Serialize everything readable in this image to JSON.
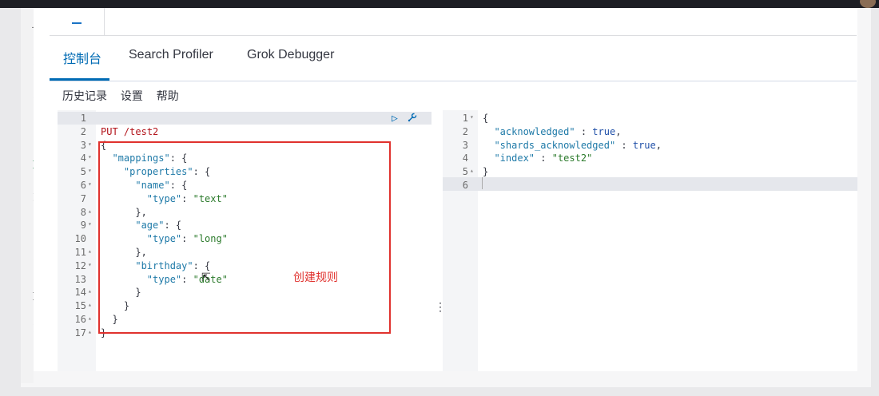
{
  "tabs": [
    {
      "label": "控制台",
      "active": true
    },
    {
      "label": "Search Profiler",
      "active": false
    },
    {
      "label": "Grok Debugger",
      "active": false
    }
  ],
  "submenu": {
    "history": "历史记录",
    "settings": "设置",
    "help": "帮助"
  },
  "request_editor": {
    "lines": [
      {
        "n": "1",
        "fold": "",
        "text": ""
      },
      {
        "n": "2",
        "fold": "",
        "text": "PUT /test2"
      },
      {
        "n": "3",
        "fold": "▾",
        "text": "{"
      },
      {
        "n": "4",
        "fold": "▾",
        "text": "  \"mappings\": {"
      },
      {
        "n": "5",
        "fold": "▾",
        "text": "    \"properties\": {"
      },
      {
        "n": "6",
        "fold": "▾",
        "text": "      \"name\": {"
      },
      {
        "n": "7",
        "fold": "",
        "text": "        \"type\": \"text\""
      },
      {
        "n": "8",
        "fold": "▴",
        "text": "      },"
      },
      {
        "n": "9",
        "fold": "▾",
        "text": "      \"age\": {"
      },
      {
        "n": "10",
        "fold": "",
        "text": "        \"type\": \"long\""
      },
      {
        "n": "11",
        "fold": "▴",
        "text": "      },"
      },
      {
        "n": "12",
        "fold": "▾",
        "text": "      \"birthday\": {"
      },
      {
        "n": "13",
        "fold": "",
        "text": "        \"type\": \"date\""
      },
      {
        "n": "14",
        "fold": "▴",
        "text": "      }"
      },
      {
        "n": "15",
        "fold": "▴",
        "text": "    }"
      },
      {
        "n": "16",
        "fold": "▴",
        "text": "  }"
      },
      {
        "n": "17",
        "fold": "▴",
        "text": "}"
      }
    ]
  },
  "response_editor": {
    "lines": [
      {
        "n": "1",
        "fold": "▾",
        "text": "{"
      },
      {
        "n": "2",
        "fold": "",
        "text": "  \"acknowledged\" : true,"
      },
      {
        "n": "3",
        "fold": "",
        "text": "  \"shards_acknowledged\" : true,"
      },
      {
        "n": "4",
        "fold": "",
        "text": "  \"index\" : \"test2\""
      },
      {
        "n": "5",
        "fold": "▴",
        "text": "}"
      },
      {
        "n": "6",
        "fold": "",
        "text": ""
      }
    ]
  },
  "annotation": {
    "label": "创建规则",
    "color": "#e0322e"
  },
  "icons": {
    "run": "play-icon",
    "settings": "wrench-icon",
    "divider": "drag-handle-icon"
  },
  "colors": {
    "accent": "#006bb4",
    "method": "#b3141b",
    "key": "#1f7aa8",
    "string": "#2b7a2b"
  }
}
